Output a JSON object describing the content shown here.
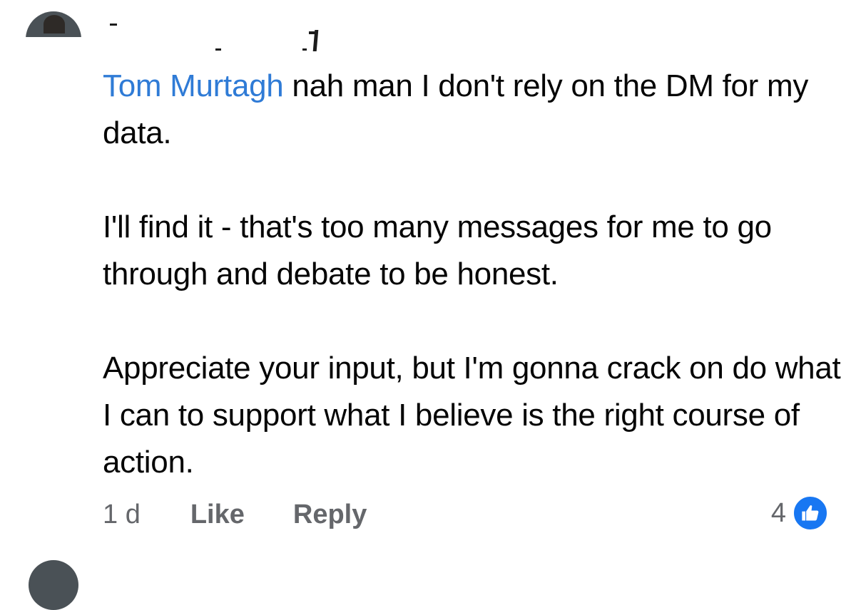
{
  "comment": {
    "mention": "Tom Murtagh",
    "paragraphs": [
      " nah man I don't rely on the DM for my data.",
      "I'll find it - that's too many messages for me to go through and debate to be honest.",
      "Appreciate your input, but I'm gonna crack on do what I can to support what I believe is the right course of action."
    ]
  },
  "actions": {
    "time": "1 d",
    "like": "Like",
    "reply": "Reply"
  },
  "reactions": {
    "count": "4",
    "icon": "thumbs-up-icon",
    "color": "#1877f2"
  },
  "colors": {
    "mention": "#2f7bd6",
    "meta": "#65676b",
    "text": "#050505"
  }
}
